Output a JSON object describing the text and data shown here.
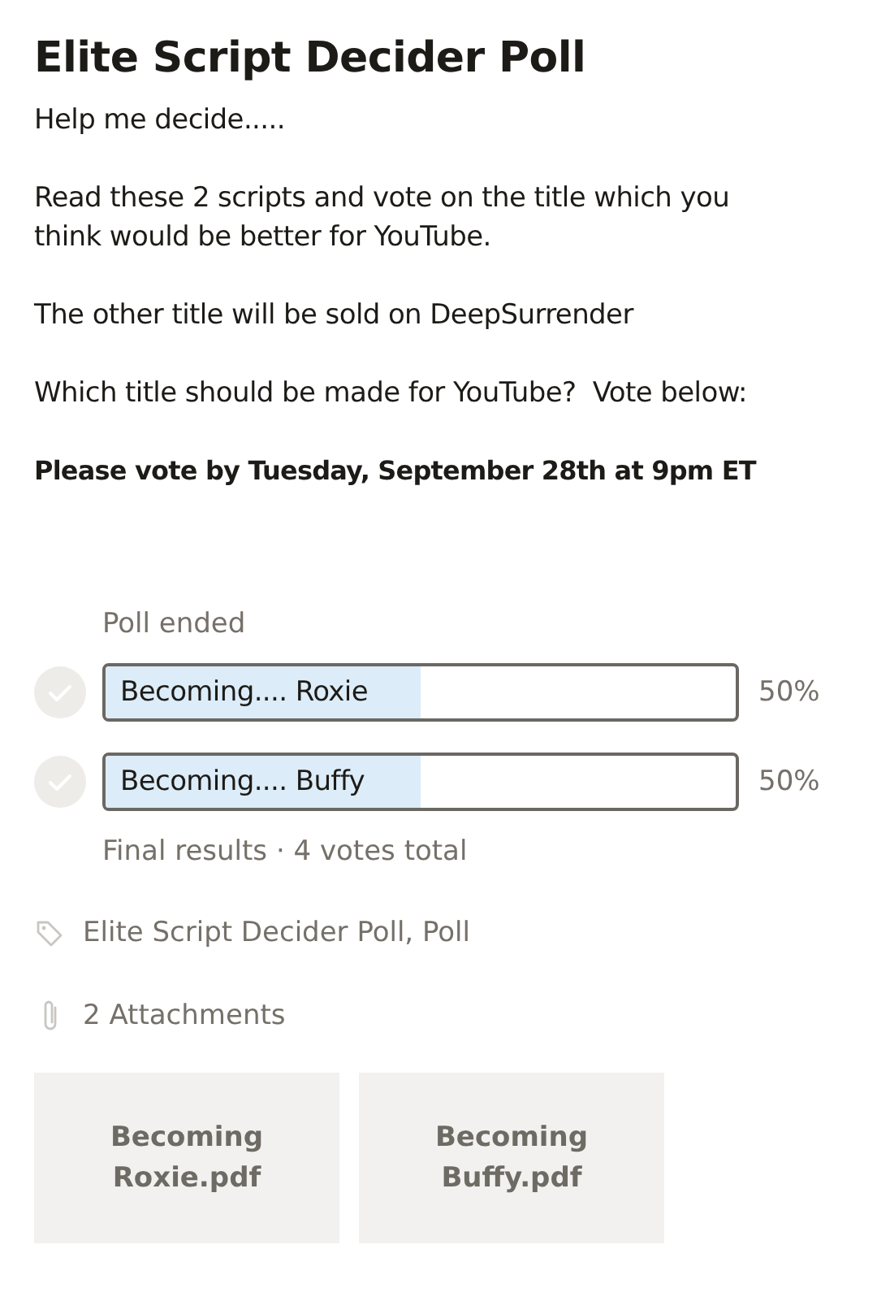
{
  "title": "Elite Script Decider Poll",
  "paragraphs": [
    {
      "text": "Help me decide.....",
      "bold": false
    },
    {
      "text": "Read these 2 scripts and vote on the title which you think would be better for YouTube.",
      "bold": false
    },
    {
      "text": "The other title will be sold on DeepSurrender",
      "bold": false
    },
    {
      "text": "Which title should be made for YouTube?  Vote below:",
      "bold": false
    },
    {
      "text": "Please vote by Tuesday, September 28th at 9pm ET",
      "bold": true
    }
  ],
  "poll": {
    "status": "Poll ended",
    "options": [
      {
        "label": "Becoming.... Roxie",
        "level": 0.5,
        "reading": "50%",
        "selected": false
      },
      {
        "label": "Becoming.... Buffy",
        "level": 0.5,
        "reading": "50%",
        "selected": false
      }
    ],
    "summary": "Final results · 4 votes total"
  },
  "tags": "Elite Script Decider Poll, Poll",
  "attachments_label": "2 Attachments",
  "attachments": [
    {
      "name": "Becoming Roxie.pdf"
    },
    {
      "name": "Becoming Buffy.pdf"
    }
  ]
}
